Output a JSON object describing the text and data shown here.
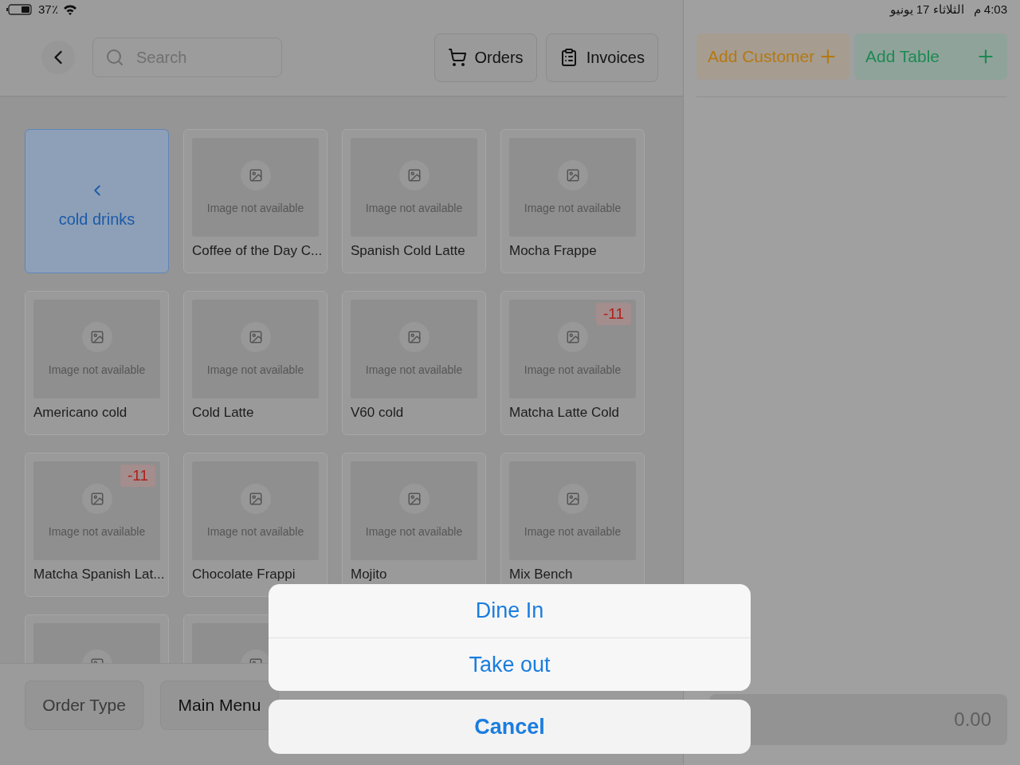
{
  "status_bar": {
    "battery": "37٪",
    "time": "4:03 م",
    "date": "الثلاثاء 17 يونيو"
  },
  "header": {
    "search": {
      "placeholder": "Search"
    },
    "buttons": [
      {
        "label": "Orders",
        "kind": "orders"
      },
      {
        "label": "Invoices",
        "kind": "invoices"
      }
    ]
  },
  "grid": [
    {
      "kind": "category",
      "label": "cold drinks",
      "selected": true
    },
    {
      "kind": "product",
      "name": "Coffee of the Day C...",
      "image_text": "Image not available"
    },
    {
      "kind": "product",
      "name": "Spanish Cold Latte",
      "image_text": "Image not available"
    },
    {
      "kind": "product",
      "name": "Mocha Frappe",
      "image_text": "Image not available"
    },
    {
      "kind": "product",
      "name": "Americano cold",
      "image_text": "Image not available"
    },
    {
      "kind": "product",
      "name": "Cold Latte",
      "image_text": "Image not available"
    },
    {
      "kind": "product",
      "name": "V60 cold",
      "image_text": "Image not available"
    },
    {
      "kind": "product",
      "name": "Matcha Latte Cold",
      "image_text": "Image not available",
      "badge": "-11"
    },
    {
      "kind": "product",
      "name": "Matcha Spanish Lat...",
      "image_text": "Image not available",
      "badge": "-11"
    },
    {
      "kind": "product",
      "name": "Chocolate Frappi",
      "image_text": "Image not available"
    },
    {
      "kind": "product",
      "name": "Mojito",
      "image_text": "Image not available"
    },
    {
      "kind": "product",
      "name": "Mix Bench",
      "image_text": "Image not available"
    },
    {
      "kind": "product"
    },
    {
      "kind": "product"
    }
  ],
  "footer": {
    "buttons": [
      {
        "label": "Order Type",
        "kind": "muted"
      },
      {
        "label": "Main Menu",
        "kind": "normal"
      }
    ]
  },
  "cart": {
    "buttons": [
      {
        "label": "Add Customer",
        "kind": "customer"
      },
      {
        "label": "Add Table",
        "kind": "table"
      }
    ],
    "total": "0.00"
  },
  "action_sheet": {
    "options": [
      "Dine In",
      "Take out"
    ],
    "cancel": "Cancel"
  }
}
